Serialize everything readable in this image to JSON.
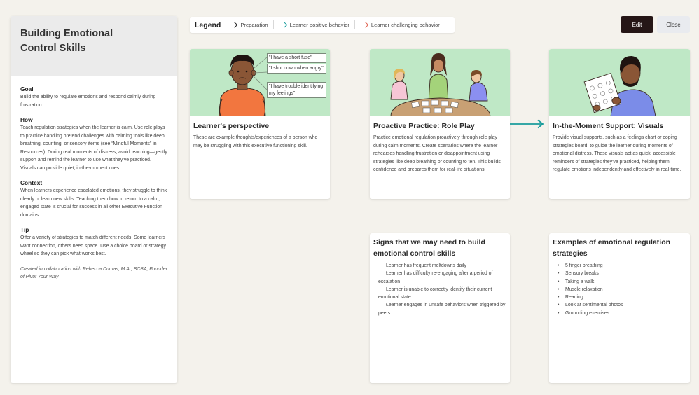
{
  "sidebar": {
    "title_line1": "Building Emotional",
    "title_line2": "Control Skills",
    "sections": [
      {
        "heading": "Goal",
        "text": "Build the ability to regulate emotions and respond calmly during frustration."
      },
      {
        "heading": "How",
        "text": "Teach regulation strategies when the learner is calm. Use role plays to practice handling pretend challenges with calming tools like deep breathing, counting, or sensory items (see “Mindful Moments” in Resources). During real moments of distress, avoid teaching—gently support and remind the learner to use what they’ve practiced. Visuals can provide quiet, in-the-moment cues."
      },
      {
        "heading": "Context",
        "text": "When learners experience escalated emotions, they struggle to think clearly or learn new skills. Teaching them how to return to a calm, engaged state is crucial for success in all other Executive Function domains."
      },
      {
        "heading": "Tip",
        "text": "Offer a variety of strategies to match different needs. Some learners want connection, others need space. Use a choice board or strategy wheel so they can pick what works best."
      }
    ],
    "credit": "Created in collaboration with Rebecca Dumas, M.A., BCBA, Founder of Pivot Your Way"
  },
  "legend": {
    "title": "Legend",
    "items": [
      {
        "label": "Preparation",
        "color": "#222222"
      },
      {
        "label": "Learner positive behavior",
        "color": "#1a9c9c"
      },
      {
        "label": "Learner challenging behavior",
        "color": "#e0624f"
      }
    ]
  },
  "toolbar": {
    "edit_label": "Edit",
    "close_label": "Close"
  },
  "cards": {
    "learner": {
      "title": "Learner's perspective",
      "text": "These are example thoughts/experiences of a person who may be struggling with this executive functioning skill.",
      "bubbles": [
        "\"I have a short fuse\"",
        "\"I shut down when angry\"",
        "\"I have trouble identifying my feelings\""
      ]
    },
    "roleplay": {
      "title": "Proactive Practice: Role Play",
      "text": "Practice emotional regulation proactively through role play during calm moments. Create scenarios where the learner rehearses handling frustration or disappointment using strategies like deep breathing or counting to ten. This builds confidence and prepares them for real-life situations."
    },
    "visuals": {
      "title": "In-the-Moment Support: Visuals",
      "text": "Provide visual supports, such as a feelings chart or coping strategies board, to guide the learner during moments of emotional distress. These visuals act as quick, accessible reminders of strategies they've practiced, helping them regulate emotions independently and effectively in real-time."
    },
    "signs": {
      "title": "Signs that we may need to build emotional control skills",
      "items": [
        "Learner has frequent meltdowns daily",
        "Learner has difficulty re-engaging after a period of escalation",
        "Learner is unable to correctly identify their current emotional state",
        "Learner engages in unsafe behaviors when triggered by peers"
      ]
    },
    "examples": {
      "title": "Examples of emotional regulation strategies",
      "items": [
        "5 finger breathing",
        "Sensory breaks",
        "Taking a walk",
        "Muscle relaxation",
        "Reading",
        "Look at sentimental photos",
        "Grounding exercises"
      ]
    }
  },
  "colors": {
    "illustration_bg": "#bfe8c6",
    "flow_arrow": "#1a9c9c",
    "edit_button": "#251616"
  }
}
